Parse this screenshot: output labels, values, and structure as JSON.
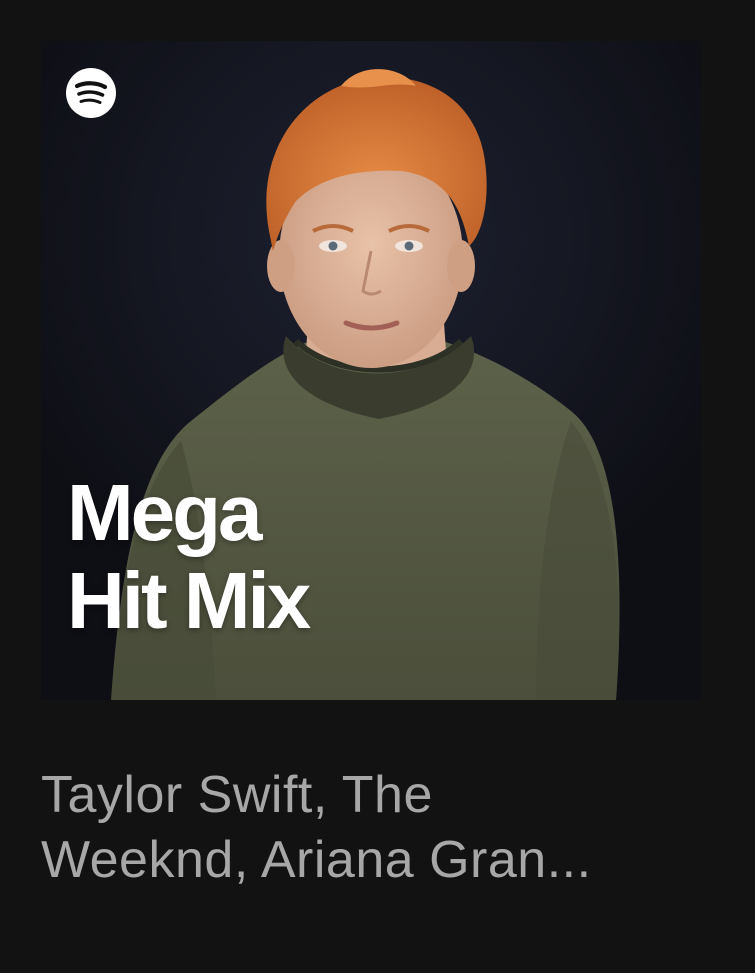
{
  "card": {
    "cover": {
      "logo_icon": "spotify-logo-icon",
      "title_line_1": "Mega",
      "title_line_2": "Hit Mix",
      "image": "portrait of a red-haired man in an olive green sweater on a dark background"
    },
    "subtitle_line_1": "Taylor Swift, The",
    "subtitle_line_2": "Weeknd, Ariana Gran..."
  },
  "colors": {
    "background": "#121212",
    "subtitle": "#a7a7a7",
    "title": "#ffffff",
    "sweater": "#5a5e47",
    "hair": "#d9783a"
  }
}
